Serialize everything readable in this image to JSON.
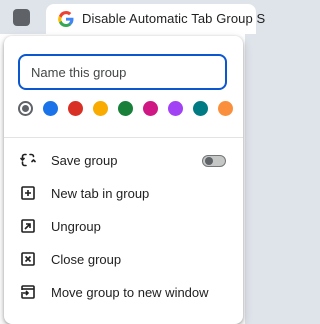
{
  "tab": {
    "title": "Disable Automatic Tab Group S",
    "favicon": "google-g-icon"
  },
  "group_editor": {
    "name_placeholder": "Name this group",
    "name_value": "",
    "colors": [
      {
        "name": "grey",
        "hex": "#5f6368",
        "selected": true
      },
      {
        "name": "blue",
        "hex": "#1a73e8",
        "selected": false
      },
      {
        "name": "red",
        "hex": "#d93025",
        "selected": false
      },
      {
        "name": "yellow",
        "hex": "#f9ab00",
        "selected": false
      },
      {
        "name": "green",
        "hex": "#188038",
        "selected": false
      },
      {
        "name": "pink",
        "hex": "#d01884",
        "selected": false
      },
      {
        "name": "purple",
        "hex": "#a142f4",
        "selected": false
      },
      {
        "name": "cyan",
        "hex": "#007b83",
        "selected": false
      },
      {
        "name": "orange",
        "hex": "#fa903e",
        "selected": false
      }
    ],
    "menu": [
      {
        "label": "Save group",
        "icon": "save-group-icon",
        "toggle": false
      },
      {
        "label": "New tab in group",
        "icon": "new-tab-icon"
      },
      {
        "label": "Ungroup",
        "icon": "ungroup-icon"
      },
      {
        "label": "Close group",
        "icon": "close-group-icon"
      },
      {
        "label": "Move group to new window",
        "icon": "move-window-icon"
      }
    ]
  }
}
